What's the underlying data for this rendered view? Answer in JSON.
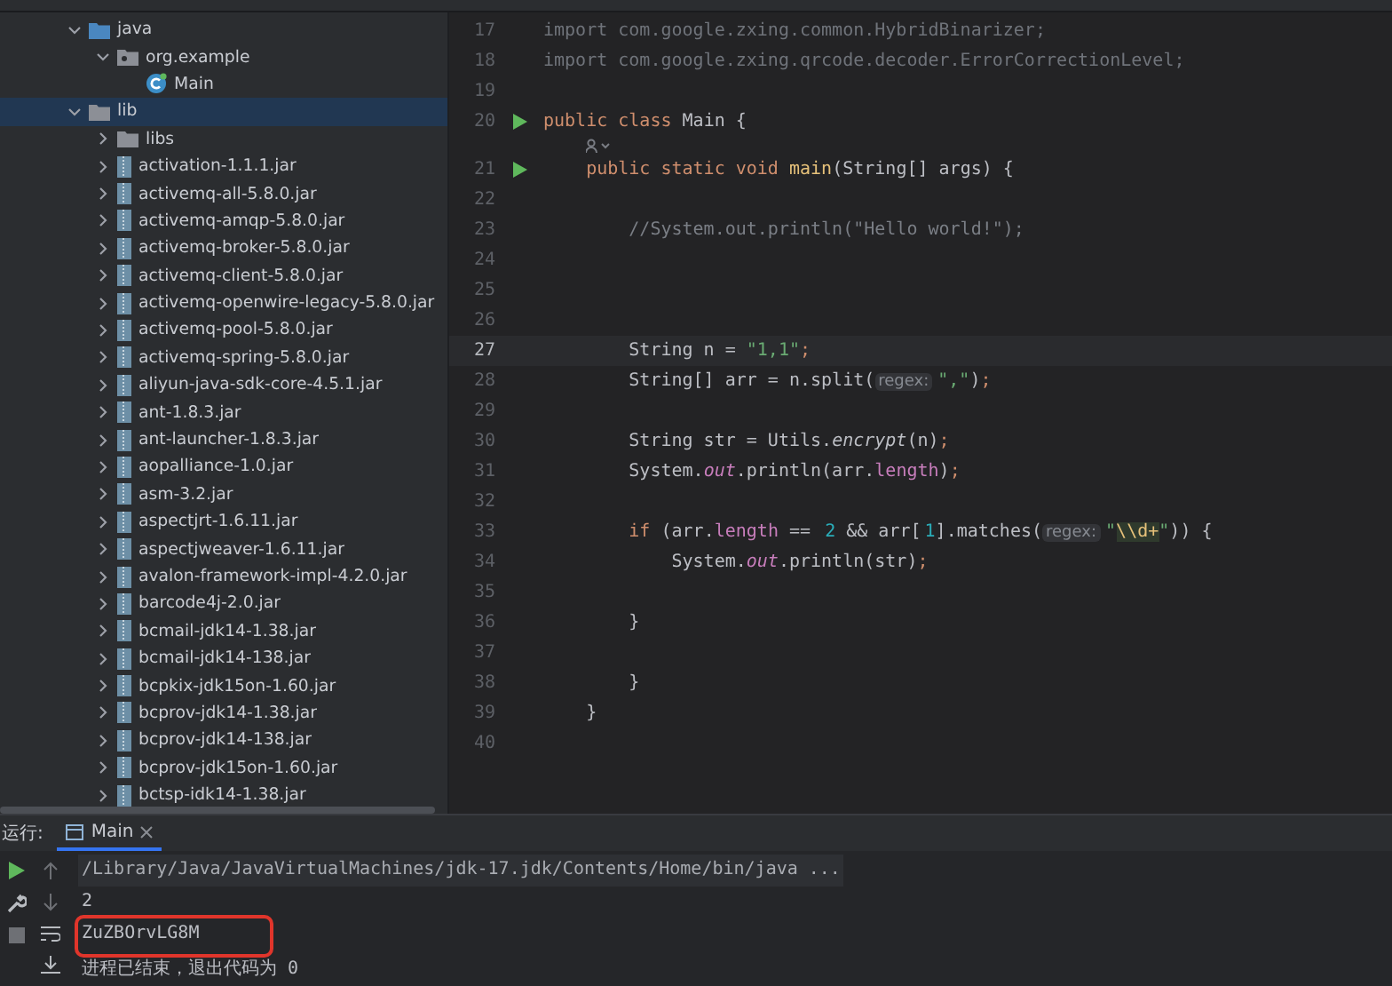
{
  "project_tree": [
    {
      "label": "java",
      "kind": "source-folder",
      "expanded": true,
      "selected": false,
      "children": [
        {
          "label": "org.example",
          "kind": "package",
          "expanded": true,
          "selected": false,
          "children": [
            {
              "label": "Main",
              "kind": "class",
              "expanded": false,
              "selected": false
            }
          ]
        }
      ]
    },
    {
      "label": "lib",
      "kind": "folder",
      "expanded": true,
      "selected": true,
      "children": [
        {
          "label": "libs",
          "kind": "folder",
          "expanded": false,
          "selected": false
        },
        {
          "label": "activation-1.1.1.jar",
          "kind": "jar",
          "expanded": false,
          "selected": false
        },
        {
          "label": "activemq-all-5.8.0.jar",
          "kind": "jar",
          "expanded": false,
          "selected": false
        },
        {
          "label": "activemq-amqp-5.8.0.jar",
          "kind": "jar",
          "expanded": false,
          "selected": false
        },
        {
          "label": "activemq-broker-5.8.0.jar",
          "kind": "jar",
          "expanded": false,
          "selected": false
        },
        {
          "label": "activemq-client-5.8.0.jar",
          "kind": "jar",
          "expanded": false,
          "selected": false
        },
        {
          "label": "activemq-openwire-legacy-5.8.0.jar",
          "kind": "jar",
          "expanded": false,
          "selected": false
        },
        {
          "label": "activemq-pool-5.8.0.jar",
          "kind": "jar",
          "expanded": false,
          "selected": false
        },
        {
          "label": "activemq-spring-5.8.0.jar",
          "kind": "jar",
          "expanded": false,
          "selected": false
        },
        {
          "label": "aliyun-java-sdk-core-4.5.1.jar",
          "kind": "jar",
          "expanded": false,
          "selected": false
        },
        {
          "label": "ant-1.8.3.jar",
          "kind": "jar",
          "expanded": false,
          "selected": false
        },
        {
          "label": "ant-launcher-1.8.3.jar",
          "kind": "jar",
          "expanded": false,
          "selected": false
        },
        {
          "label": "aopalliance-1.0.jar",
          "kind": "jar",
          "expanded": false,
          "selected": false
        },
        {
          "label": "asm-3.2.jar",
          "kind": "jar",
          "expanded": false,
          "selected": false
        },
        {
          "label": "aspectjrt-1.6.11.jar",
          "kind": "jar",
          "expanded": false,
          "selected": false
        },
        {
          "label": "aspectjweaver-1.6.11.jar",
          "kind": "jar",
          "expanded": false,
          "selected": false
        },
        {
          "label": "avalon-framework-impl-4.2.0.jar",
          "kind": "jar",
          "expanded": false,
          "selected": false
        },
        {
          "label": "barcode4j-2.0.jar",
          "kind": "jar",
          "expanded": false,
          "selected": false
        },
        {
          "label": "bcmail-jdk14-1.38.jar",
          "kind": "jar",
          "expanded": false,
          "selected": false
        },
        {
          "label": "bcmail-jdk14-138.jar",
          "kind": "jar",
          "expanded": false,
          "selected": false
        },
        {
          "label": "bcpkix-jdk15on-1.60.jar",
          "kind": "jar",
          "expanded": false,
          "selected": false
        },
        {
          "label": "bcprov-jdk14-1.38.jar",
          "kind": "jar",
          "expanded": false,
          "selected": false
        },
        {
          "label": "bcprov-jdk14-138.jar",
          "kind": "jar",
          "expanded": false,
          "selected": false
        },
        {
          "label": "bcprov-jdk15on-1.60.jar",
          "kind": "jar",
          "expanded": false,
          "selected": false
        },
        {
          "label": "bctsp-idk14-1.38.jar",
          "kind": "jar",
          "expanded": false,
          "selected": false
        }
      ]
    }
  ],
  "editor": {
    "lines": [
      {
        "kind": "code",
        "number": "17",
        "runnable": false,
        "current": false,
        "tokens": [
          {
            "text": "import com.google.zxing.common.HybridBinarizer;",
            "kind": "unused"
          }
        ]
      },
      {
        "kind": "code",
        "number": "18",
        "runnable": false,
        "current": false,
        "tokens": [
          {
            "text": "import com.google.zxing.qrcode.decoder.ErrorCorrectionLevel;",
            "kind": "unused"
          }
        ]
      },
      {
        "kind": "code",
        "number": "19",
        "runnable": false,
        "current": false
      },
      {
        "kind": "code",
        "number": "20",
        "runnable": true,
        "current": false,
        "tokens": [
          {
            "text": "public class ",
            "kind": "kw"
          },
          {
            "text": "Main {",
            "kind": "txt"
          }
        ]
      },
      {
        "kind": "inlay"
      },
      {
        "kind": "code",
        "number": "21",
        "runnable": true,
        "current": false,
        "tokens": [
          {
            "text": "    public static void ",
            "kind": "kw"
          },
          {
            "text": "main",
            "kind": "fn"
          },
          {
            "text": "(String[] args) {",
            "kind": "txt"
          }
        ]
      },
      {
        "kind": "code",
        "number": "22",
        "runnable": false,
        "current": false
      },
      {
        "kind": "code",
        "number": "23",
        "runnable": false,
        "current": false,
        "tokens": [
          {
            "text": "        //System.out.println(\"Hello world!\");",
            "kind": "cmt"
          }
        ]
      },
      {
        "kind": "code",
        "number": "24",
        "runnable": false,
        "current": false
      },
      {
        "kind": "code",
        "number": "25",
        "runnable": false,
        "current": false
      },
      {
        "kind": "code",
        "number": "26",
        "runnable": false,
        "current": false
      },
      {
        "kind": "code",
        "number": "27",
        "runnable": false,
        "current": true,
        "tokens": [
          {
            "text": "        String n = ",
            "kind": "txt"
          },
          {
            "text": "\"1,1\"",
            "kind": "str"
          },
          {
            "text": ";",
            "kind": "punct"
          }
        ]
      },
      {
        "kind": "code",
        "number": "28",
        "runnable": false,
        "current": false,
        "tokens": [
          {
            "text": "        String[] arr = n.split(",
            "kind": "txt"
          },
          {
            "text": "regex:",
            "kind": "hint"
          },
          {
            "text": "\",\"",
            "kind": "str"
          },
          {
            "text": ")",
            "kind": "txt"
          },
          {
            "text": ";",
            "kind": "punct"
          }
        ]
      },
      {
        "kind": "code",
        "number": "29",
        "runnable": false,
        "current": false
      },
      {
        "kind": "code",
        "number": "30",
        "runnable": false,
        "current": false,
        "tokens": [
          {
            "text": "        String str = Utils.",
            "kind": "txt"
          },
          {
            "text": "encrypt",
            "kind": "static"
          },
          {
            "text": "(n)",
            "kind": "txt"
          },
          {
            "text": ";",
            "kind": "punct"
          }
        ]
      },
      {
        "kind": "code",
        "number": "31",
        "runnable": false,
        "current": false,
        "tokens": [
          {
            "text": "        System.",
            "kind": "txt"
          },
          {
            "text": "out",
            "kind": "field"
          },
          {
            "text": ".println(arr.",
            "kind": "txt"
          },
          {
            "text": "length",
            "kind": "prop"
          },
          {
            "text": ")",
            "kind": "txt"
          },
          {
            "text": ";",
            "kind": "punct"
          }
        ]
      },
      {
        "kind": "code",
        "number": "32",
        "runnable": false,
        "current": false
      },
      {
        "kind": "code",
        "number": "33",
        "runnable": false,
        "current": false,
        "tokens": [
          {
            "text": "        if",
            "kind": "kw"
          },
          {
            "text": " (arr.",
            "kind": "txt"
          },
          {
            "text": "length",
            "kind": "prop"
          },
          {
            "text": " == ",
            "kind": "txt"
          },
          {
            "text": "2",
            "kind": "num"
          },
          {
            "text": " && arr[",
            "kind": "txt"
          },
          {
            "text": "1",
            "kind": "num"
          },
          {
            "text": "].matches(",
            "kind": "txt"
          },
          {
            "text": "regex:",
            "kind": "hint"
          },
          {
            "text": "\"",
            "kind": "str"
          },
          {
            "text": "\\\\d+",
            "kind": "regex"
          },
          {
            "text": "\"",
            "kind": "str"
          },
          {
            "text": ")) {",
            "kind": "txt"
          }
        ]
      },
      {
        "kind": "code",
        "number": "34",
        "runnable": false,
        "current": false,
        "tokens": [
          {
            "text": "            System.",
            "kind": "txt"
          },
          {
            "text": "out",
            "kind": "field"
          },
          {
            "text": ".println(str)",
            "kind": "txt"
          },
          {
            "text": ";",
            "kind": "punct"
          }
        ]
      },
      {
        "kind": "code",
        "number": "35",
        "runnable": false,
        "current": false
      },
      {
        "kind": "code",
        "number": "36",
        "runnable": false,
        "current": false,
        "tokens": [
          {
            "text": "        }",
            "kind": "txt"
          }
        ]
      },
      {
        "kind": "code",
        "number": "37",
        "runnable": false,
        "current": false
      },
      {
        "kind": "code",
        "number": "38",
        "runnable": false,
        "current": false,
        "tokens": [
          {
            "text": "        }",
            "kind": "txt"
          }
        ]
      },
      {
        "kind": "code",
        "number": "39",
        "runnable": false,
        "current": false,
        "tokens": [
          {
            "text": "    }",
            "kind": "txt"
          }
        ]
      },
      {
        "kind": "code",
        "number": "40",
        "runnable": false,
        "current": false
      }
    ]
  },
  "run_panel": {
    "label": "运行:",
    "tabs": [
      {
        "label": "Main",
        "selected": true
      }
    ],
    "output": [
      {
        "text": "/Library/Java/JavaVirtualMachines/jdk-17.jdk/Contents/Home/bin/java ...",
        "kind": "command",
        "marked": false
      },
      {
        "text": "2",
        "kind": "stdout",
        "marked": false
      },
      {
        "text": "ZuZBOrvLG8M",
        "kind": "stdout",
        "marked": true
      },
      {
        "text": "进程已结束，退出代码为 0",
        "kind": "stdout",
        "marked": false
      }
    ]
  }
}
